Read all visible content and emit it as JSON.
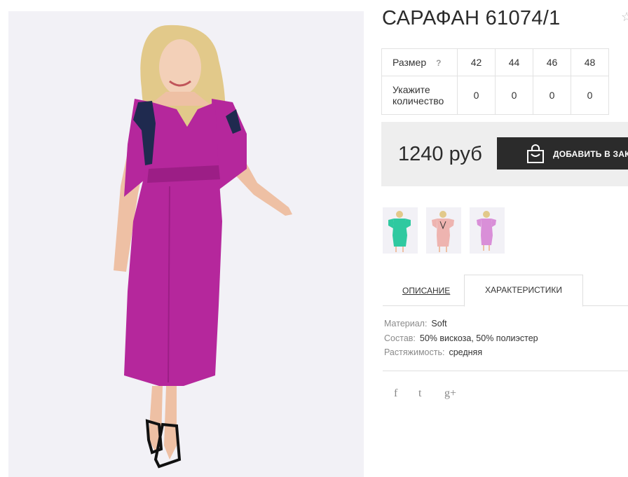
{
  "product": {
    "title": "САРАФАН 61074/1",
    "favorite_icon": "star-icon"
  },
  "sizes_table": {
    "size_label": "Размер",
    "help_mark": "?",
    "sizes": [
      "42",
      "44",
      "46",
      "48"
    ],
    "qty_label": "Укажите количество",
    "quantities": [
      "0",
      "0",
      "0",
      "0"
    ]
  },
  "purchase": {
    "price": "1240 руб",
    "add_to_cart": "ДОБАВИТЬ В ЗАК",
    "cart_icon": "shopping-bag-icon"
  },
  "thumbnails": [
    {
      "color": "#2fc9a0",
      "name": "mint"
    },
    {
      "color": "#eeb4b0",
      "name": "pink"
    },
    {
      "color": "#d98fd8",
      "name": "lilac"
    }
  ],
  "main_photo": {
    "dress_color": "#b5279c"
  },
  "tabs": {
    "description": "ОПИСАНИЕ",
    "characteristics": "ХАРАКТЕРИСТИКИ",
    "active": "characteristics"
  },
  "properties": [
    {
      "key": "Материал:",
      "value": "Soft"
    },
    {
      "key": "Состав:",
      "value": "50% вискоза, 50% полиэстер"
    },
    {
      "key": "Растяжимость:",
      "value": "средняя"
    }
  ],
  "social": {
    "facebook": "f",
    "twitter": "t",
    "google_plus": "g+"
  }
}
